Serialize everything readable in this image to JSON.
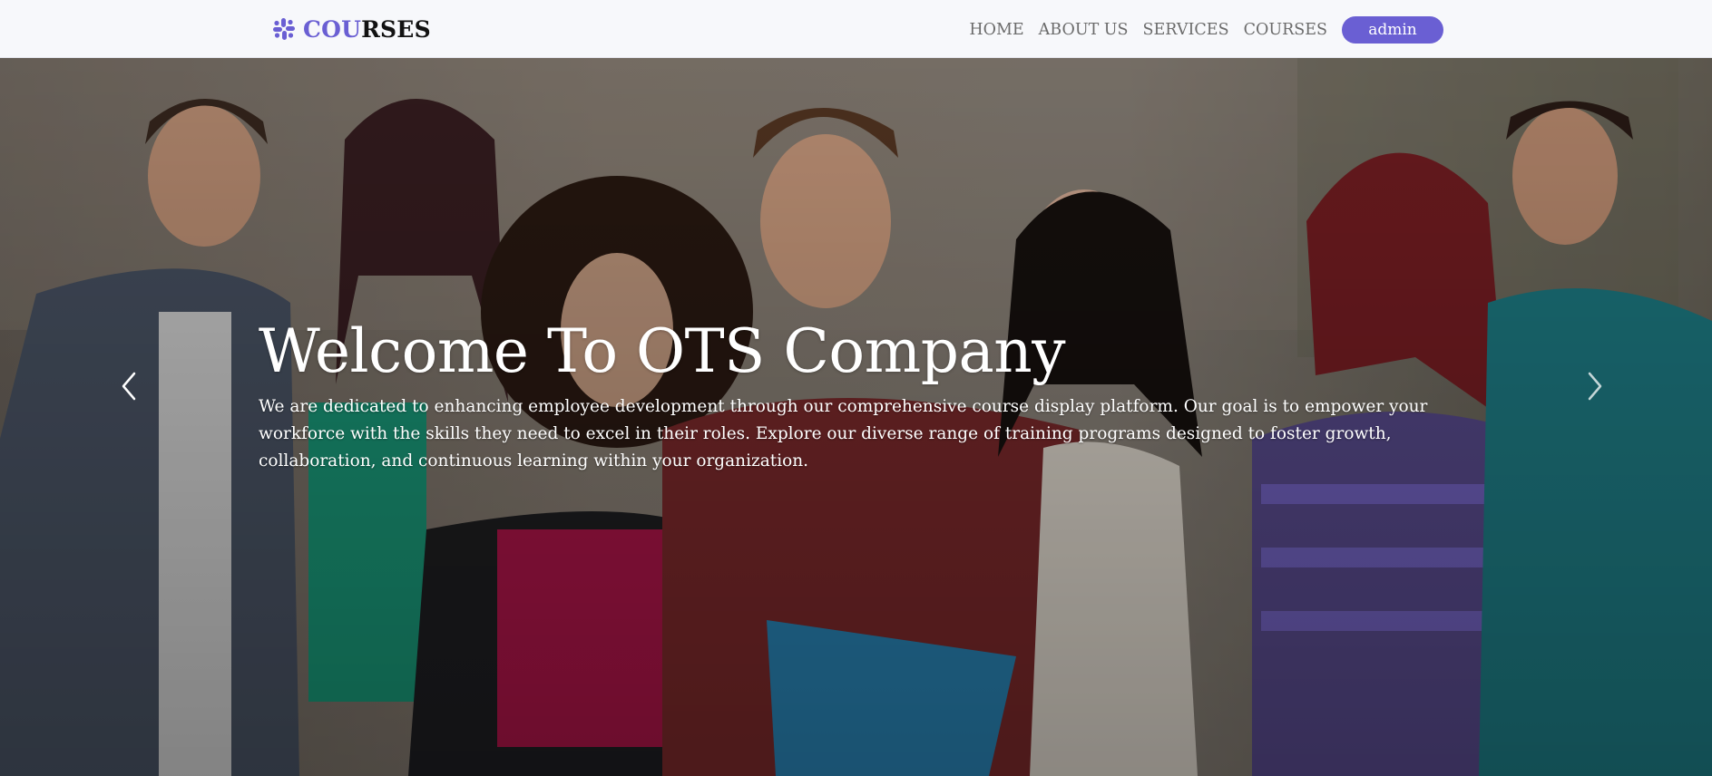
{
  "brand": {
    "icon": "slack-like-logo-icon",
    "text_accent": "COU",
    "text_rest": "RSES",
    "accent_color": "#6a5fd3"
  },
  "nav": {
    "items": [
      {
        "label": "HOME"
      },
      {
        "label": "ABOUT US"
      },
      {
        "label": "SERVICES"
      },
      {
        "label": "COURSES"
      }
    ],
    "user_button": {
      "label": "admin",
      "color": "#6a5fd3"
    }
  },
  "hero": {
    "title": "Welcome To OTS Company",
    "description": "We are dedicated to enhancing employee development through our comprehensive course display platform. Our goal is to empower your workforce with the skills they need to excel in their roles. Explore our diverse range of training programs designed to foster growth, collaboration, and continuous learning within your organization.",
    "prev_icon": "chevron-left-icon",
    "next_icon": "chevron-right-icon"
  }
}
